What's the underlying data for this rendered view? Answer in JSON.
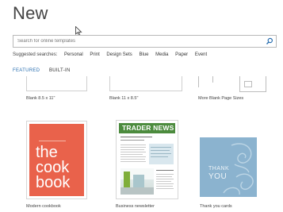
{
  "header": {
    "title": "New"
  },
  "search": {
    "placeholder": "Search for online templates",
    "icon": "search-icon"
  },
  "suggested": {
    "label": "Suggested searches:",
    "items": [
      "Personal",
      "Print",
      "Design Sets",
      "Blue",
      "Media",
      "Paper",
      "Event"
    ]
  },
  "tabs": {
    "featured": "FEATURED",
    "builtin": "BUILT-IN"
  },
  "templates": [
    {
      "label": "Blank 8.5 x 11\""
    },
    {
      "label": "Blank 11 x 8.5\""
    },
    {
      "label": "More Blank Page Sizes"
    },
    {
      "label": "Modern cookbook"
    },
    {
      "label": "Business newsletter"
    },
    {
      "label": "Thank you cards"
    }
  ],
  "cookbook": {
    "words": [
      "the",
      "cook",
      "book"
    ]
  },
  "newsletter": {
    "masthead": "TRADER NEWS"
  },
  "thanks": {
    "line1": "THANK",
    "line2": "YOU"
  },
  "colors": {
    "accent": "#2a6fb0",
    "cookbook": "#e9624b",
    "newsletter": "#4c8b3e",
    "thanks": "#8bb3cf"
  }
}
